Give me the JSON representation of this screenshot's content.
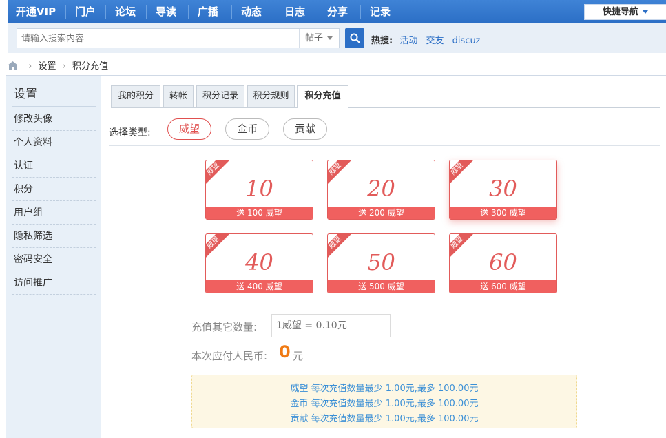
{
  "nav": {
    "items": [
      "开通VIP",
      "门户",
      "论坛",
      "导读",
      "广播",
      "动态",
      "日志",
      "分享",
      "记录"
    ],
    "quick_nav": "快捷导航"
  },
  "search": {
    "placeholder": "请输入搜索内容",
    "type": "帖子",
    "hot_label": "热搜:",
    "hot_links": [
      "活动",
      "交友",
      "discuz"
    ]
  },
  "breadcrumb": [
    "设置",
    "积分充值"
  ],
  "sidebar": {
    "title": "设置",
    "items": [
      "修改头像",
      "个人资料",
      "认证",
      "积分",
      "用户组",
      "隐私筛选",
      "密码安全",
      "访问推广"
    ]
  },
  "tabs": [
    "我的积分",
    "转帐",
    "积分记录",
    "积分规则",
    "积分充值"
  ],
  "active_tab": "积分充值",
  "type_label": "选择类型:",
  "types": [
    "威望",
    "金币",
    "贡献"
  ],
  "selected_type": "威望",
  "cards": [
    {
      "ribbon": "威望",
      "amount": "10",
      "bonus": "送 100 威望"
    },
    {
      "ribbon": "威望",
      "amount": "20",
      "bonus": "送 200 威望"
    },
    {
      "ribbon": "威望",
      "amount": "30",
      "bonus": "送 300 威望"
    },
    {
      "ribbon": "威望",
      "amount": "40",
      "bonus": "送 400 威望"
    },
    {
      "ribbon": "威望",
      "amount": "50",
      "bonus": "送 500 威望"
    },
    {
      "ribbon": "威望",
      "amount": "60",
      "bonus": "送 600 威望"
    }
  ],
  "other": {
    "label": "充值其它数量:",
    "placeholder": "1威望 = 0.10元"
  },
  "pay": {
    "label": "本次应付人民币:",
    "amount": "0",
    "unit": "元"
  },
  "notice": [
    "威望 每次充值数量最少 1.00元,最多 100.00元",
    "金币 每次充值数量最少 1.00元,最多 100.00元",
    "贡献 每次充值数量最少 1.00元,最多 100.00元"
  ],
  "colors": {
    "nav_blue": "#2c6fc6",
    "accent_red": "#e25b5a",
    "pay_orange": "#f07a14",
    "notice_text": "#3a8fd6"
  }
}
